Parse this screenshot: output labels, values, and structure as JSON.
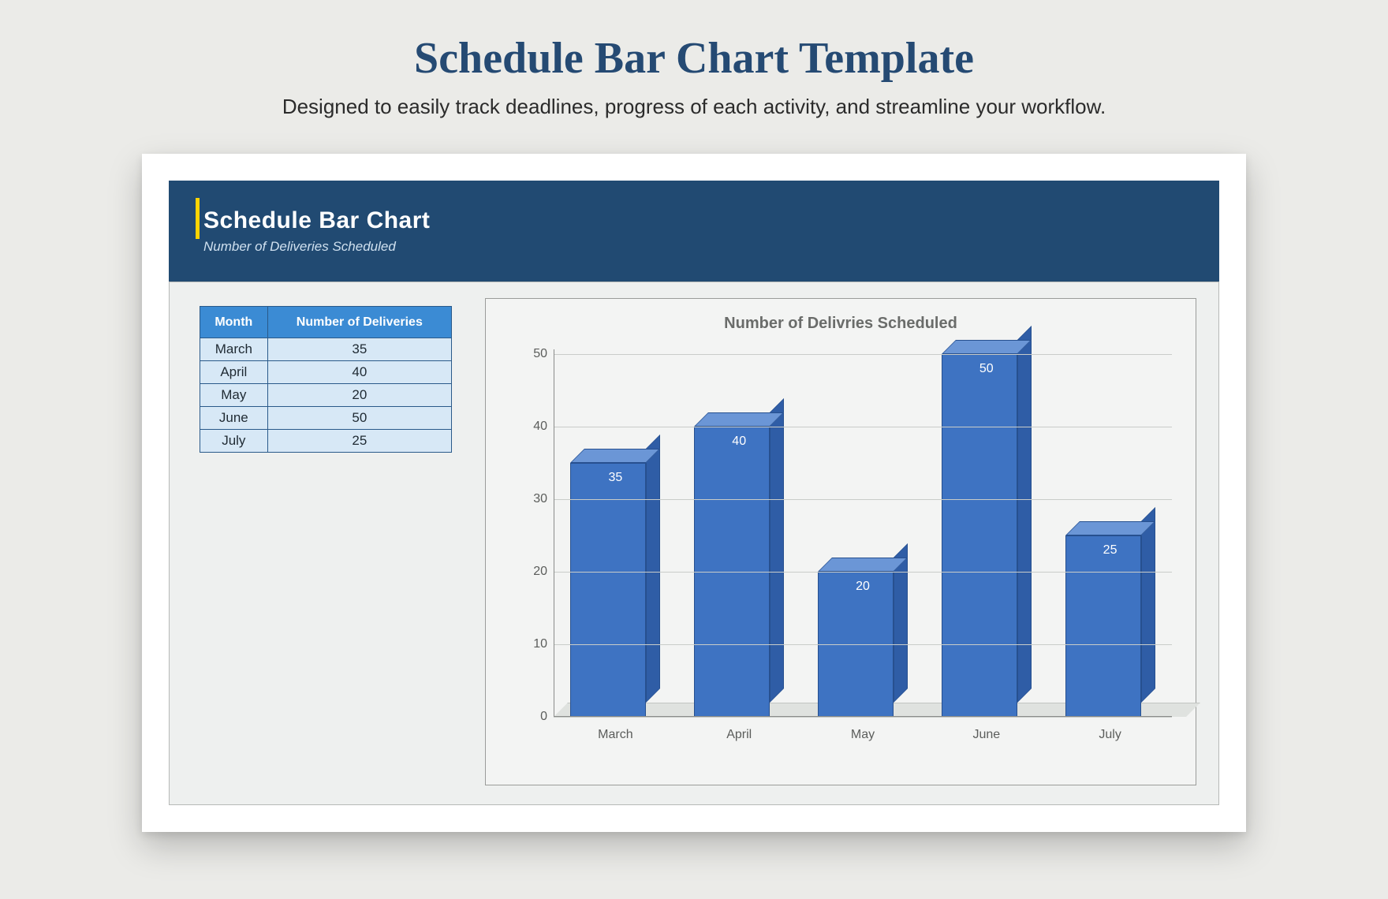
{
  "page": {
    "title": "Schedule Bar Chart Template",
    "subtitle": "Designed to easily track deadlines, progress of each activity, and streamline your workflow."
  },
  "banner": {
    "title": "Schedule Bar Chart",
    "subtitle": "Number of Deliveries Scheduled"
  },
  "table": {
    "headers": {
      "month": "Month",
      "deliveries": "Number of Deliveries"
    },
    "rows": [
      {
        "month": "March",
        "deliveries": "35"
      },
      {
        "month": "April",
        "deliveries": "40"
      },
      {
        "month": "May",
        "deliveries": "20"
      },
      {
        "month": "June",
        "deliveries": "50"
      },
      {
        "month": "July",
        "deliveries": "25"
      }
    ]
  },
  "chart_data": {
    "type": "bar",
    "title": "Number of Delivries Scheduled",
    "xlabel": "",
    "ylabel": "",
    "categories": [
      "March",
      "April",
      "May",
      "June",
      "July"
    ],
    "values": [
      35,
      40,
      20,
      50,
      25
    ],
    "ylim": [
      0,
      50
    ],
    "yticks": [
      0,
      10,
      20,
      30,
      40,
      50
    ],
    "bar_color": "#3e73c2"
  }
}
